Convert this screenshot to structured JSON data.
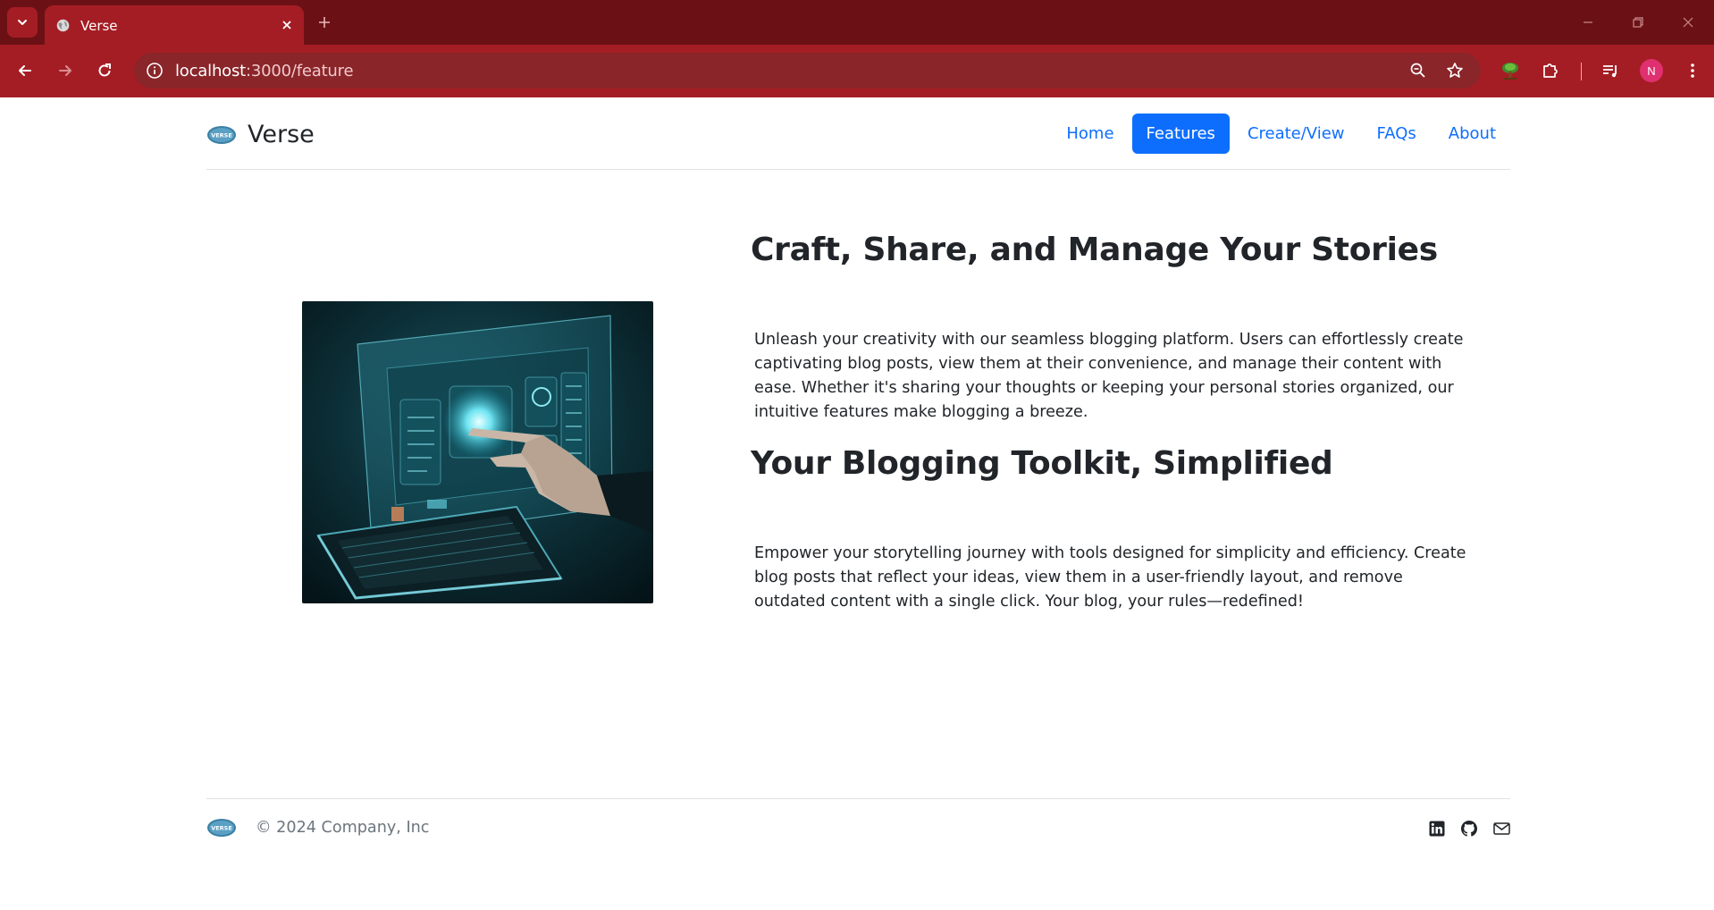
{
  "browser": {
    "tab_title": "Verse",
    "url_host": "localhost",
    "url_path": ":3000/feature",
    "avatar_letter": "N"
  },
  "colors": {
    "chrome_dark": "#6b1115",
    "chrome": "#a51d24",
    "link": "#0d6efd",
    "text": "#212529",
    "muted": "#6c757d"
  },
  "header": {
    "brand_name": "Verse",
    "logo_text": "VERSE",
    "nav": [
      {
        "label": "Home",
        "active": false
      },
      {
        "label": "Features",
        "active": true
      },
      {
        "label": "Create/View",
        "active": false
      },
      {
        "label": "FAQs",
        "active": false
      },
      {
        "label": "About",
        "active": false
      }
    ]
  },
  "features": [
    {
      "title": "Craft, Share, and Manage Your Stories",
      "text": "Unleash your creativity with our seamless blogging platform. Users can effortlessly create captivating blog posts, view them at their convenience, and manage their content with ease. Whether it's sharing your thoughts or keeping your personal stories organized, our intuitive features make blogging a breeze."
    },
    {
      "title": "Your Blogging Toolkit, Simplified",
      "text": "Empower your storytelling journey with tools designed for simplicity and efficiency. Create blog posts that reflect your ideas, view them in a user-friendly layout, and remove outdated content with a single click. Your blog, your rules—redefined!"
    }
  ],
  "footer": {
    "copyright": "© 2024 Company, Inc",
    "social": [
      "linkedin-icon",
      "github-icon",
      "mail-icon"
    ]
  }
}
